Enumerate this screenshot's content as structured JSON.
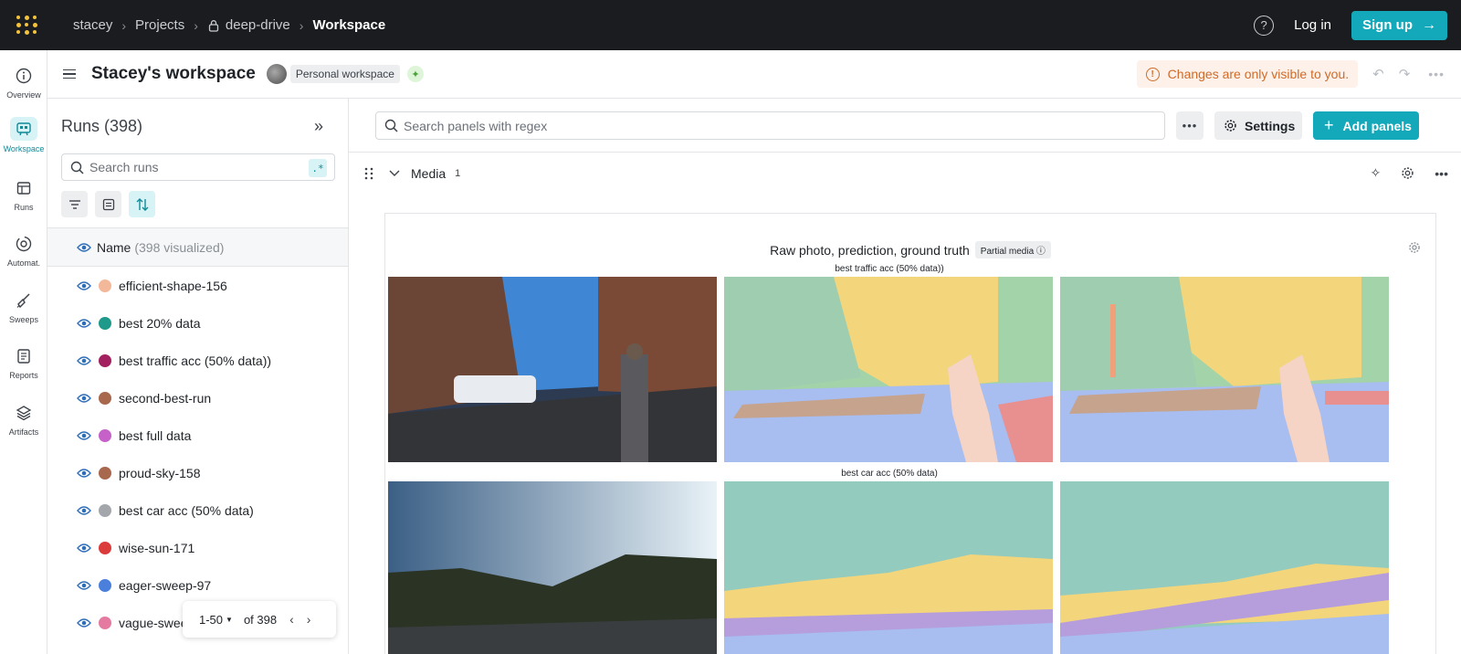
{
  "topbar": {
    "breadcrumbs": [
      "stacey",
      "Projects",
      "deep-drive",
      "Workspace"
    ],
    "login_label": "Log in",
    "signup_label": "Sign up",
    "help_glyph": "?",
    "accent_color": "#13a9ba"
  },
  "rail": {
    "items": [
      {
        "label": "Overview",
        "icon": "info-icon"
      },
      {
        "label": "Workspace",
        "icon": "workspace-icon",
        "active": true
      },
      {
        "label": "Runs",
        "icon": "table-icon"
      },
      {
        "label": "Automat.",
        "icon": "automation-icon"
      },
      {
        "label": "Sweeps",
        "icon": "broom-icon"
      },
      {
        "label": "Reports",
        "icon": "report-icon"
      },
      {
        "label": "Artifacts",
        "icon": "layers-icon"
      }
    ]
  },
  "header": {
    "title": "Stacey's workspace",
    "badge": "Personal workspace",
    "notice": "Changes are only visible to you."
  },
  "runs": {
    "title": "Runs (398)",
    "search_placeholder": "Search runs",
    "regex_label": ".*",
    "column_name": "Name",
    "column_count": "(398 visualized)",
    "items": [
      {
        "name": "efficient-shape-156",
        "color": "#f3b89a"
      },
      {
        "name": "best 20% data",
        "color": "#1f9a8a"
      },
      {
        "name": "best traffic acc (50% data))",
        "color": "#a3215e"
      },
      {
        "name": "second-best-run",
        "color": "#a8684e"
      },
      {
        "name": "best full data",
        "color": "#c561c8"
      },
      {
        "name": "proud-sky-158",
        "color": "#a8684e"
      },
      {
        "name": "best car acc (50% data)",
        "color": "#a3a6aa"
      },
      {
        "name": "wise-sun-171",
        "color": "#dc3b3b"
      },
      {
        "name": "eager-sweep-97",
        "color": "#4a7fdc"
      },
      {
        "name": "vague-swee",
        "color": "#e57aa0"
      }
    ],
    "pager": {
      "range": "1-50",
      "of": "of 398"
    }
  },
  "main": {
    "search_placeholder": "Search panels with regex",
    "more_label": "•••",
    "settings_label": "Settings",
    "add_panels_label": "Add panels",
    "section_title": "Media",
    "section_count": "1",
    "card_title": "Raw photo, prediction, ground truth",
    "partial_badge": "Partial media",
    "row_labels": [
      "best traffic acc (50% data))",
      "best car acc (50% data)"
    ]
  }
}
